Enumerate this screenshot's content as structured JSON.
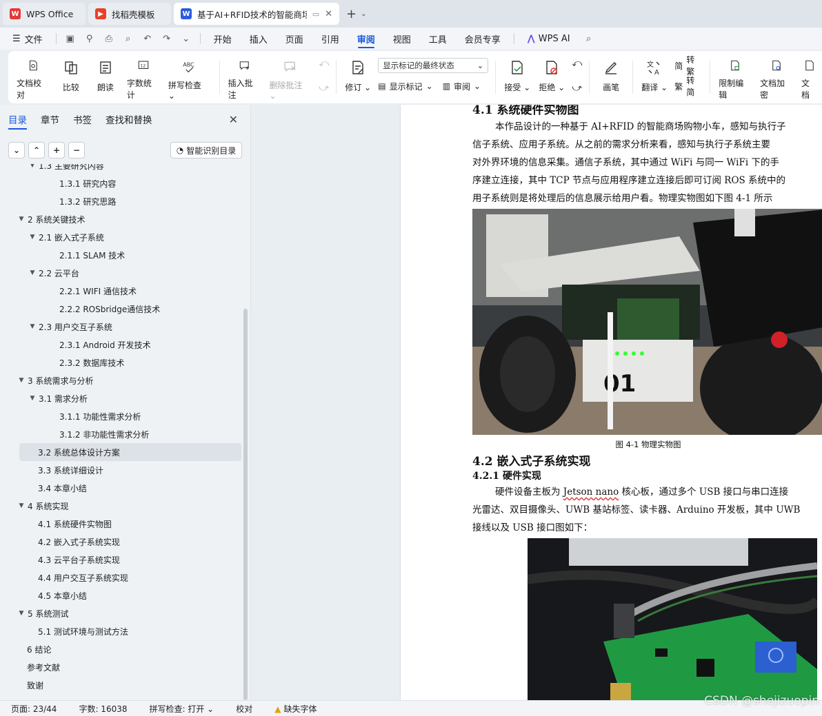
{
  "tabs": [
    {
      "label": "WPS Office",
      "active": false
    },
    {
      "label": "找稻壳模板",
      "active": false
    },
    {
      "label": "基于AI+RFID技术的智能商场",
      "active": true
    }
  ],
  "menu": {
    "file": "文件",
    "items": [
      "开始",
      "插入",
      "页面",
      "引用",
      "审阅",
      "视图",
      "工具",
      "会员专享"
    ],
    "active": "审阅",
    "ai": "WPS AI"
  },
  "ribbon": {
    "doc_check": "文档校对",
    "compare": "比较",
    "read_aloud": "朗读",
    "word_count": "字数统计",
    "spell_check": "拼写检查",
    "insert_comment": "插入批注",
    "delete_comment": "删除批注",
    "track_changes": "修订",
    "markup_select": "显示标记的最终状态",
    "show_markup": "显示标记",
    "review": "审阅",
    "accept": "接受",
    "reject": "拒绝",
    "pen": "画笔",
    "translate": "翻译",
    "to_traditional": "转繁",
    "to_simplified": "转简",
    "restrict_edit": "限制编辑",
    "encrypt": "文档加密",
    "doc_more": "文档"
  },
  "nav": {
    "tabs": [
      "目录",
      "章节",
      "书签",
      "查找和替换"
    ],
    "smart_toc": "智能识别目录",
    "toc": [
      {
        "label": "1.3 主要研究内容",
        "level": 2,
        "arrow": true
      },
      {
        "label": "1.3.1 研究内容",
        "level": 3
      },
      {
        "label": "1.3.2 研究思路",
        "level": 3
      },
      {
        "label": "2  系统关键技术",
        "level": 1,
        "arrow": true
      },
      {
        "label": "2.1 嵌入式子系统",
        "level": 2,
        "arrow": true
      },
      {
        "label": "2.1.1 SLAM 技术",
        "level": 3
      },
      {
        "label": "2.2 云平台",
        "level": 2,
        "arrow": true
      },
      {
        "label": "2.2.1 WIFI 通信技术",
        "level": 3
      },
      {
        "label": "2.2.2 ROSbridge通信技术",
        "level": 3
      },
      {
        "label": "2.3 用户交互子系统",
        "level": 2,
        "arrow": true
      },
      {
        "label": "2.3.1 Android 开发技术",
        "level": 3
      },
      {
        "label": "2.3.2  数据库技术",
        "level": 3
      },
      {
        "label": "3 系统需求与分析",
        "level": 1,
        "arrow": true
      },
      {
        "label": "3.1 需求分析",
        "level": 2,
        "arrow": true
      },
      {
        "label": "3.1.1  功能性需求分析",
        "level": 3
      },
      {
        "label": "3.1.2  非功能性需求分析",
        "level": 3
      },
      {
        "label": "3.2 系统总体设计方案",
        "level": 2,
        "selected": true
      },
      {
        "label": "3.3 系统详细设计",
        "level": 2
      },
      {
        "label": "3.4 本章小结",
        "level": 2
      },
      {
        "label": "4  系统实现",
        "level": 1,
        "arrow": true
      },
      {
        "label": "4.1 系统硬件实物图",
        "level": 2
      },
      {
        "label": "4.2 嵌入式子系统实现",
        "level": 2
      },
      {
        "label": "4.3 云平台子系统实现",
        "level": 2
      },
      {
        "label": "4.4  用户交互子系统实现",
        "level": 2
      },
      {
        "label": "4.5  本章小结",
        "level": 2
      },
      {
        "label": "5  系统测试",
        "level": 1,
        "arrow": true
      },
      {
        "label": "5.1  测试环境与测试方法",
        "level": 2
      },
      {
        "label": "6  结论",
        "level": 1
      },
      {
        "label": "参考文献",
        "level": 1
      },
      {
        "label": "致谢",
        "level": 1
      }
    ]
  },
  "doc": {
    "h41": "4.1 系统硬件实物图",
    "p1": [
      "本作品设计的一种基于 AI+RFID 的智能商场购物小车，感知与执行子",
      "信子系统、应用子系统。从之前的需求分析来看，感知与执行子系统主要",
      "对外界环境的信息采集。通信子系统，其中通过 WiFi 与同一 WiFi 下的手",
      "序建立连接，其中 TCP 节点与应用程序建立连接后即可订阅 ROS 系统中的",
      "用子系统则是将处理后的信息展示给用户看。物理实物图如下图 4-1 所示"
    ],
    "fig_caption": "图 4-1  物理实物图",
    "h42": "4.2 嵌入式子系统实现",
    "h421": "4.2.1  硬件实现",
    "p2_prefix": "硬件设备主板为 ",
    "p2_term": "Jetson nano",
    "p2_suffix": " 核心板，通过多个 USB 接口与串口连接",
    "p2_lines": [
      "光雷达、双目摄像头、UWB 基站标签、读卡器、Arduino 开发板，其中 UWB",
      "接线以及 USB 接口图如下："
    ]
  },
  "status": {
    "page": "页面: 23/44",
    "words": "字数: 16038",
    "spell": "拼写检查: 打开",
    "proof": "校对",
    "missing_font": "缺失字体"
  },
  "watermark": "CSDN @shejizuopin",
  "colors": {
    "accent": "#1a56db",
    "wps_red": "#e53935",
    "word_blue": "#2b5bde"
  }
}
